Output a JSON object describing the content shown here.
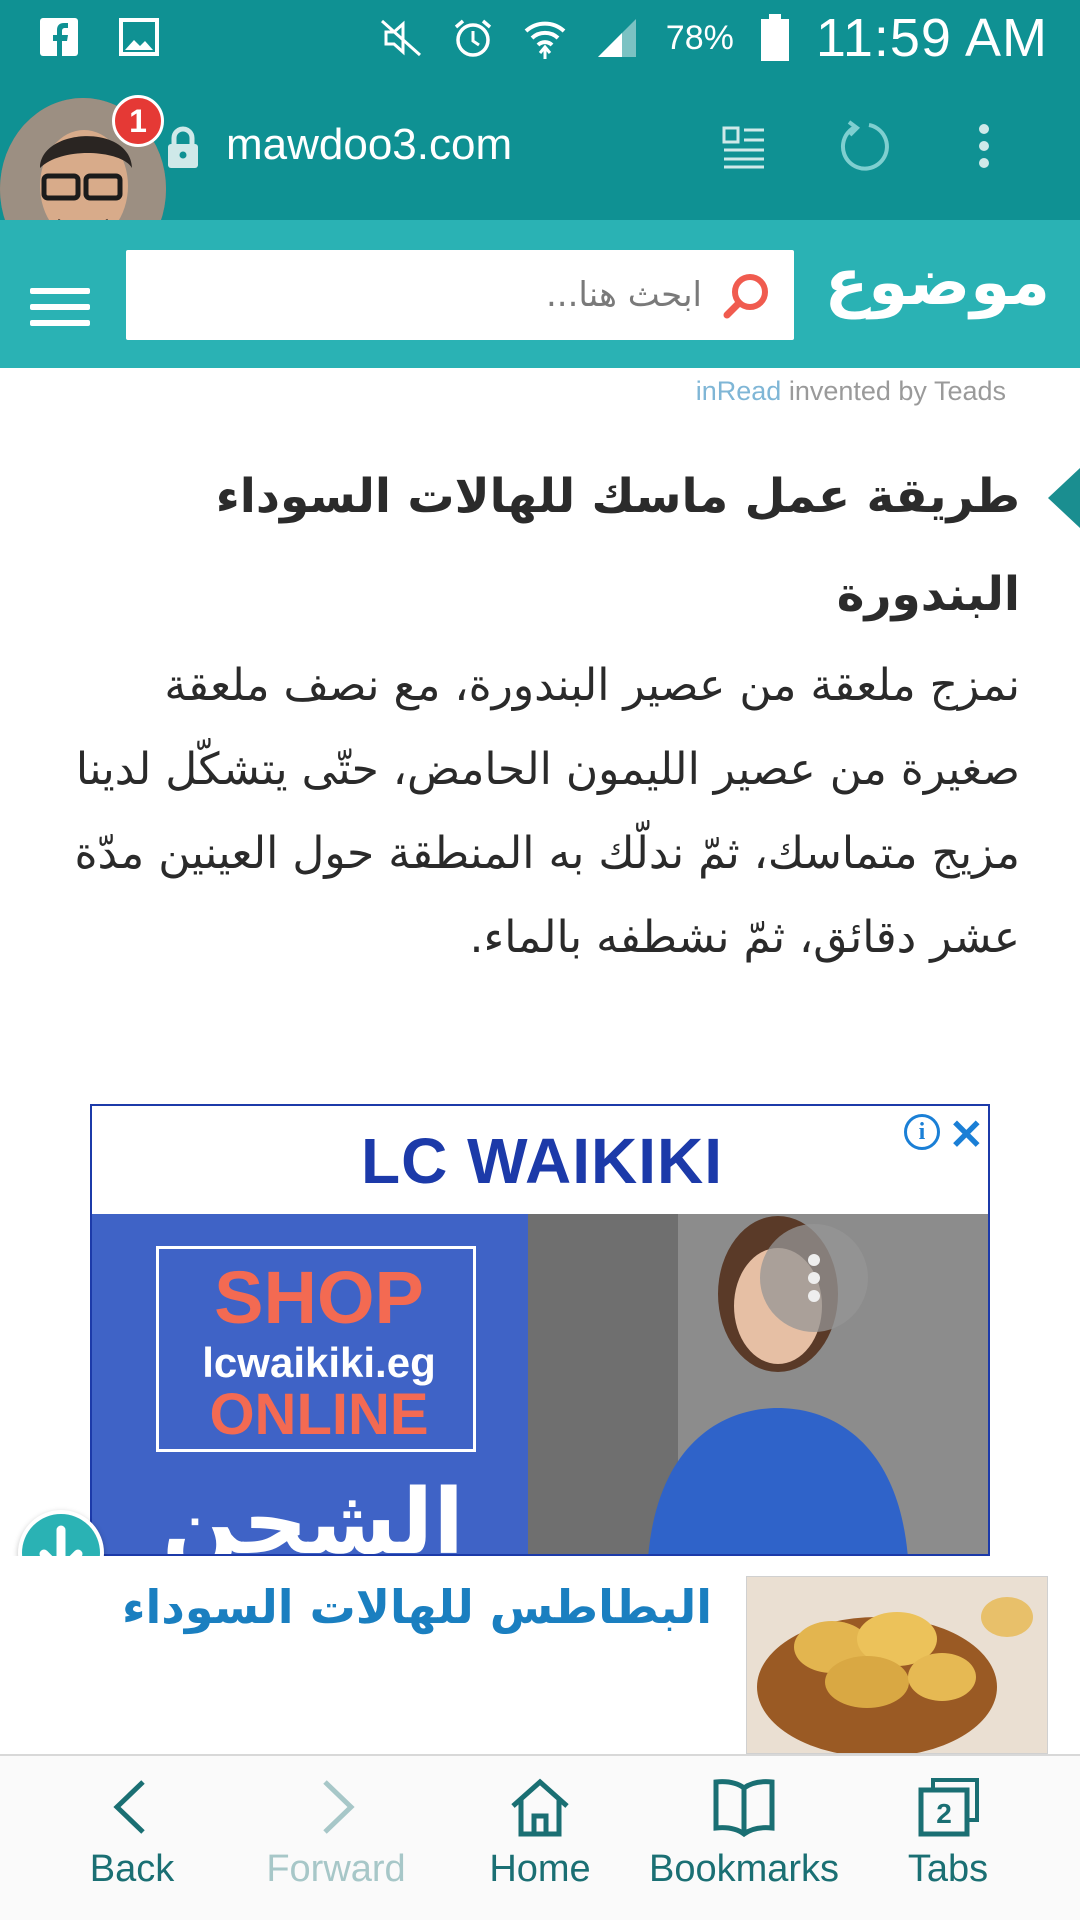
{
  "status_bar": {
    "battery": "78%",
    "time": "11:59 AM",
    "icons": [
      "facebook-icon",
      "gallery-icon",
      "mute-icon",
      "alarm-icon",
      "wifi-icon",
      "signal-icon",
      "battery-icon"
    ]
  },
  "browser": {
    "url": "mawdoo3.com",
    "notification_count": "1",
    "accent_color": "#0f9193"
  },
  "site_header": {
    "logo_text": "موضوع",
    "search_placeholder": "ابحث هنا...",
    "color": "#2ab2b4"
  },
  "teads": {
    "inread": "inRead",
    "invented_by": " invented by Teads"
  },
  "article": {
    "title": "طريقة عمل ماسك للهالات السوداء",
    "subtitle": "البندورة",
    "body": "نمزج ملعقة من عصير البندورة، مع نصف ملعقة صغيرة من عصير الليمون الحامض، حتّى يتشكّل لدينا مزيج متماسك، ثمّ ندلّك به المنطقة حول العينين مدّة عشر دقائق، ثمّ نشطفه بالماء."
  },
  "ad": {
    "brand": "LC WAIKIKI",
    "shop_line1": "SHOP",
    "shop_line2": "lcwaikiki.eg",
    "shop_line3": "ONLINE",
    "arabic_text": "الشحن"
  },
  "related": {
    "title": "البطاطس للهالات السوداء"
  },
  "bottom_nav": {
    "back": "Back",
    "forward": "Forward",
    "home": "Home",
    "bookmarks": "Bookmarks",
    "tabs": "Tabs",
    "tab_count": "2"
  }
}
